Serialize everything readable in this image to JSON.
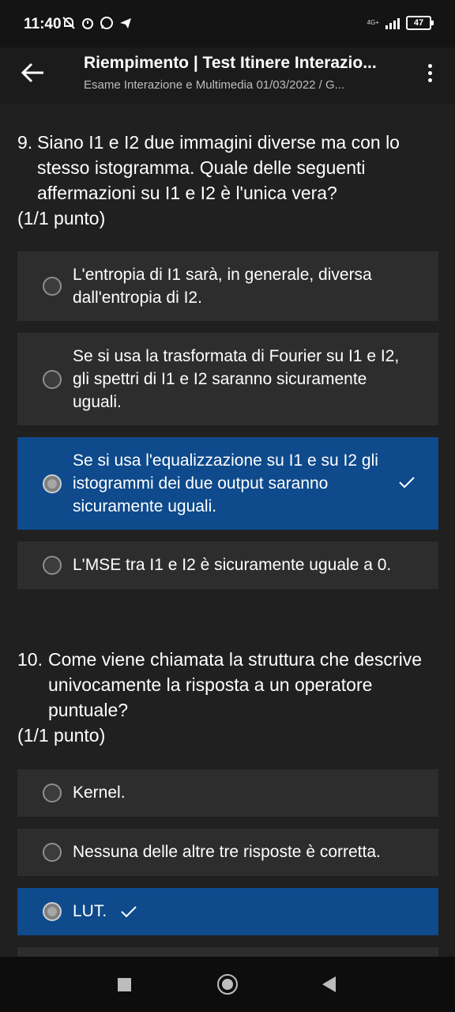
{
  "status_bar": {
    "time": "11:40",
    "network": "4G+",
    "battery": "47"
  },
  "header": {
    "title": "Riempimento | Test Itinere Interazio...",
    "subtitle": "Esame Interazione e Multimedia 01/03/2022 / G..."
  },
  "questions": [
    {
      "number": "9.",
      "text": "Siano I1 e I2 due immagini diverse ma con lo stesso istogramma. Quale delle seguenti affermazioni su I1 e I2 è l'unica vera?",
      "points": "(1/1 punto)",
      "options": [
        {
          "label": "L'entropia di I1 sarà, in generale, diversa dall'entropia di I2.",
          "selected": false
        },
        {
          "label": "Se si usa la trasformata di Fourier su I1 e I2, gli spettri di I1 e I2 saranno sicuramente uguali.",
          "selected": false
        },
        {
          "label": "Se si usa l'equalizzazione su I1 e su I2 gli istogrammi dei due output saranno sicuramente uguali.",
          "selected": true,
          "correct": true
        },
        {
          "label": "L'MSE tra I1 e I2 è sicuramente uguale a 0.",
          "selected": false
        }
      ]
    },
    {
      "number": "10.",
      "text": "Come viene chiamata la struttura che descrive univocamente la risposta a un operatore puntuale?",
      "points": "(1/1 punto)",
      "options": [
        {
          "label": "Kernel.",
          "selected": false
        },
        {
          "label": "Nessuna delle altre tre risposte è corretta.",
          "selected": false
        },
        {
          "label": "LUT.",
          "selected": true,
          "correct": true
        }
      ]
    }
  ],
  "colors": {
    "background": "#202020",
    "option_bg": "#2d2d2d",
    "selected_bg": "#0e4a8c"
  },
  "icons": {
    "back": "arrow-left-icon",
    "more": "more-vertical-icon",
    "check": "check-icon"
  }
}
